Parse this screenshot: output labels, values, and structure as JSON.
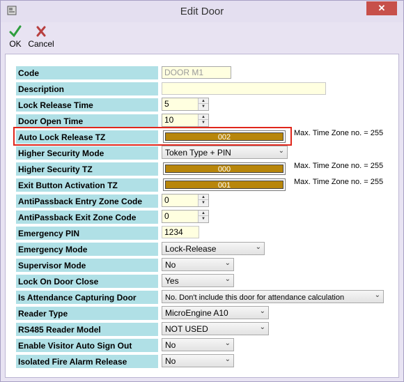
{
  "window": {
    "title": "Edit Door",
    "close_glyph": "✕"
  },
  "toolbar": {
    "ok_label": "OK",
    "cancel_label": "Cancel"
  },
  "icons": {
    "app": "app-icon",
    "ok": "checkmark-icon",
    "cancel": "x-icon",
    "close": "close-icon",
    "dropdown": "chevron-down-icon"
  },
  "colors": {
    "label_bg": "#b0e0e6",
    "timezone_bar": "#b8860b",
    "highlight": "#e0261b",
    "input_bg": "#ffffe0"
  },
  "fields": {
    "code": {
      "label": "Code",
      "value": "DOOR M1"
    },
    "description": {
      "label": "Description",
      "value": ""
    },
    "lock_release_time": {
      "label": "Lock Release Time",
      "value": "5"
    },
    "door_open_time": {
      "label": "Door Open Time",
      "value": "10"
    },
    "auto_lock_release_tz": {
      "label": "Auto Lock Release TZ",
      "value": "002",
      "note": "Max. Time Zone no. = 255"
    },
    "higher_security_mode": {
      "label": "Higher Security Mode",
      "value": "Token Type + PIN"
    },
    "higher_security_tz": {
      "label": "Higher Security TZ",
      "value": "000",
      "note": "Max. Time Zone no. = 255"
    },
    "exit_button_activation_tz": {
      "label": "Exit Button Activation TZ",
      "value": "001",
      "note": "Max. Time Zone no. = 255"
    },
    "antipassback_entry": {
      "label": "AntiPassback Entry Zone Code",
      "value": "0"
    },
    "antipassback_exit": {
      "label": "AntiPassback Exit Zone Code",
      "value": "0"
    },
    "emergency_pin": {
      "label": "Emergency PIN",
      "value": "1234"
    },
    "emergency_mode": {
      "label": "Emergency Mode",
      "value": "Lock-Release"
    },
    "supervisor_mode": {
      "label": "Supervisor Mode",
      "value": "No"
    },
    "lock_on_door_close": {
      "label": "Lock On Door Close",
      "value": "Yes"
    },
    "attendance_door": {
      "label": "Is Attendance Capturing Door",
      "value": "No. Don't include this door for attendance calculation"
    },
    "reader_type": {
      "label": "Reader Type",
      "value": "MicroEngine A10"
    },
    "rs485_reader_model": {
      "label": "RS485 Reader Model",
      "value": "NOT USED"
    },
    "visitor_auto_sign_out": {
      "label": "Enable Visitor Auto Sign Out",
      "value": "No"
    },
    "isolated_fire_alarm": {
      "label": "Isolated Fire Alarm Release",
      "value": "No"
    }
  }
}
